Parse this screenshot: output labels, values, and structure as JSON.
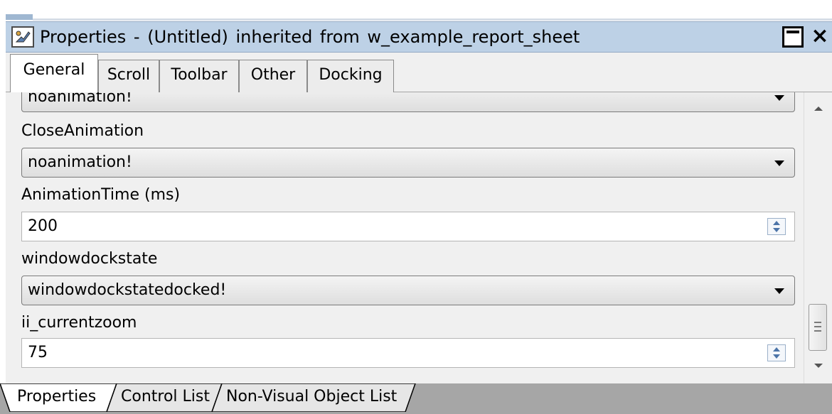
{
  "window": {
    "title": "Properties -  (Untitled)  inherited  from  w_example_report_sheet",
    "maximize_glyph": "",
    "close_glyph": "×"
  },
  "tabs": [
    {
      "label": "General"
    },
    {
      "label": "Scroll"
    },
    {
      "label": "Toolbar"
    },
    {
      "label": "Other"
    },
    {
      "label": "Docking"
    }
  ],
  "fields": {
    "top_partial_value": "noanimation!",
    "close_animation": {
      "label": "CloseAnimation",
      "value": "noanimation!"
    },
    "animation_time": {
      "label": "AnimationTime (ms)",
      "value": "200"
    },
    "windowdockstate": {
      "label": "windowdockstate",
      "value": "windowdockstatedocked!"
    },
    "ii_currentzoom": {
      "label": "ii_currentzoom",
      "value": "75"
    }
  },
  "bottom_tabs": [
    {
      "label": "Properties"
    },
    {
      "label": "Control List"
    },
    {
      "label": "Non-Visual Object List"
    }
  ],
  "colors": {
    "titlebar": "#bdd1e6",
    "panel": "#f0f0f0",
    "bottom_strip": "#a6a6a6"
  }
}
